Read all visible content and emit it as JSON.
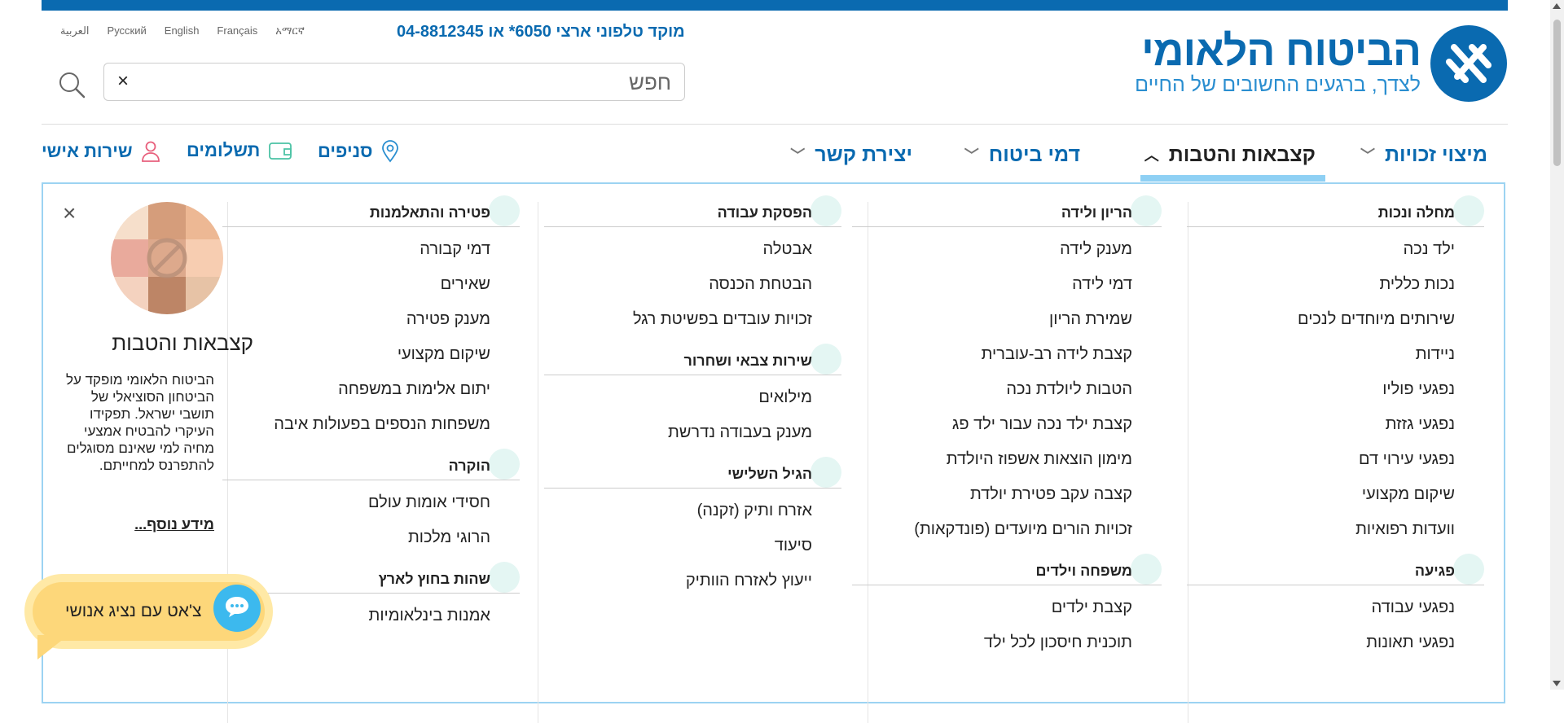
{
  "header": {
    "logo_title": "הביטוח הלאומי",
    "logo_tagline": "לצדך, ברגעים החשובים של החיים",
    "phone_text": "מוקד טלפוני ארצי 6050* או 04-8812345",
    "languages": [
      "العربية",
      "Русский",
      "English",
      "Français",
      "አማርኛ"
    ],
    "search": {
      "placeholder": "חפש",
      "clear_label": "×"
    }
  },
  "nav": {
    "main": [
      {
        "label": "מיצוי זכויות",
        "expanded": false
      },
      {
        "label": "קצבאות והטבות",
        "expanded": true
      },
      {
        "label": "דמי ביטוח",
        "expanded": false
      },
      {
        "label": "יצירת קשר",
        "expanded": false
      }
    ],
    "utility": [
      {
        "label": "סניפים",
        "icon": "map-pin-icon"
      },
      {
        "label": "תשלומים",
        "icon": "wallet-icon"
      },
      {
        "label": "שירות אישי",
        "icon": "user-icon"
      }
    ]
  },
  "mega_menu": {
    "columns": [
      {
        "sections": [
          {
            "title": "מחלה ונכות",
            "links": [
              "ילד נכה",
              "נכות כללית",
              "שירותים מיוחדים לנכים",
              "ניידות",
              "נפגעי פוליו",
              "נפגעי גזזת",
              "נפגעי עירוי דם",
              "שיקום מקצועי",
              "וועדות רפואיות"
            ]
          },
          {
            "title": "פגיעה",
            "links": [
              "נפגעי עבודה",
              "נפגעי תאונות"
            ]
          }
        ]
      },
      {
        "sections": [
          {
            "title": "הריון ולידה",
            "links": [
              "מענק לידה",
              "דמי לידה",
              "שמירת הריון",
              "קצבת לידה רב-עוברית",
              "הטבות ליולדת נכה",
              "קצבת ילד נכה עבור ילד פג",
              "מימון הוצאות אשפוז היולדת",
              "קצבה עקב פטירת יולדת",
              "זכויות הורים מיועדים (פונדקאות)"
            ]
          },
          {
            "title": "משפחה וילדים",
            "links": [
              "קצבת ילדים",
              "תוכנית חיסכון לכל ילד"
            ]
          }
        ]
      },
      {
        "sections": [
          {
            "title": "הפסקת עבודה",
            "links": [
              "אבטלה",
              "הבטחת הכנסה",
              "זכויות עובדים בפשיטת רגל"
            ]
          },
          {
            "title": "שירות צבאי ושחרור",
            "links": [
              "מילואים",
              "מענק בעבודה נדרשת"
            ]
          },
          {
            "title": "הגיל השלישי",
            "links": [
              "אזרח ותיק (זקנה)",
              "סיעוד",
              "ייעוץ לאזרח הוותיק"
            ]
          }
        ]
      },
      {
        "sections": [
          {
            "title": "פטירה והתאלמנות",
            "links": [
              "דמי קבורה",
              "שאירים",
              "מענק פטירה",
              "שיקום מקצועי",
              "יתום אלימות במשפחה",
              "משפחות הנספים בפעולות איבה"
            ]
          },
          {
            "title": "הוקרה",
            "links": [
              "חסידי אומות עולם",
              "הרוגי מלכות"
            ]
          },
          {
            "title": "שהות בחוץ לארץ",
            "links": [
              "אמנות בינלאומיות"
            ]
          }
        ]
      }
    ],
    "info": {
      "title": "קצבאות והטבות",
      "description": "הביטוח הלאומי מופקד על הביטחון הסוציאלי של תושבי ישראל. תפקידו העיקרי להבטיח אמצעי מחיה למי שאינם מסוגלים להתפרנס למחייתם.",
      "more_link": "מידע נוסף..."
    }
  },
  "chat": {
    "label": "צ'אט עם נציג אנושי"
  },
  "colors": {
    "brand_blue": "#0a6ab0",
    "accent_light_blue": "#8ed0f4",
    "chat_yellow": "#fdd77a",
    "chat_button": "#3cb9ee"
  }
}
